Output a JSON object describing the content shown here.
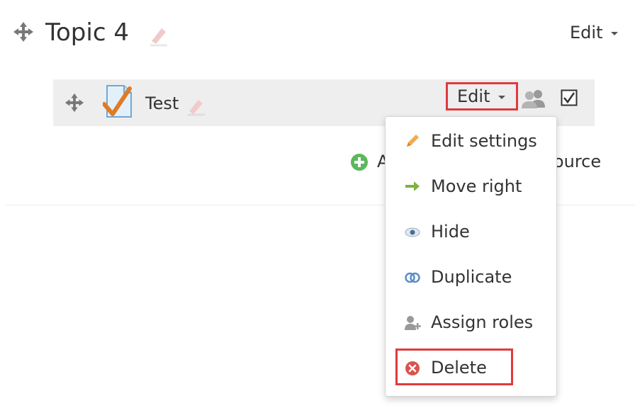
{
  "section": {
    "title": "Topic 4",
    "edit_label": "Edit"
  },
  "activity": {
    "name": "Test",
    "edit_label": "Edit"
  },
  "add_resource": {
    "visible_prefix": "A",
    "visible_suffix": "source"
  },
  "menu": {
    "items": [
      {
        "label": "Edit settings",
        "icon": "pencil-icon"
      },
      {
        "label": "Move right",
        "icon": "arrow-right-icon"
      },
      {
        "label": "Hide",
        "icon": "eye-icon"
      },
      {
        "label": "Duplicate",
        "icon": "duplicate-icon"
      },
      {
        "label": "Assign roles",
        "icon": "assign-roles-icon"
      },
      {
        "label": "Delete",
        "icon": "delete-icon"
      }
    ]
  },
  "colors": {
    "highlight_border": "#e03a3e",
    "row_background": "#eeeeee",
    "add_icon_green": "#5cb85c",
    "delete_icon_red": "#d9534f"
  }
}
